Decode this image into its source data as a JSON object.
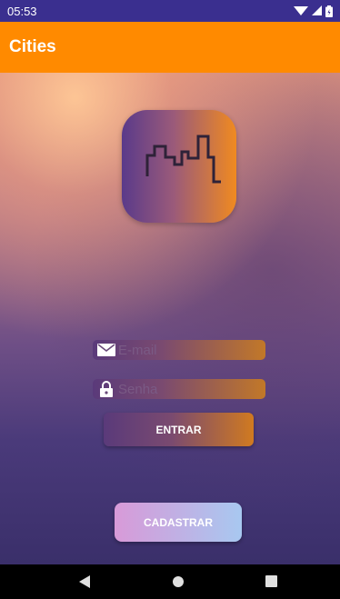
{
  "status_bar": {
    "time": "05:53",
    "icons": [
      "wifi-icon",
      "signal-icon",
      "battery-icon"
    ]
  },
  "app_bar": {
    "title": "Cities",
    "color": "#ff8a00"
  },
  "logo": {
    "icon": "city-skyline-icon"
  },
  "form": {
    "email": {
      "icon": "mail-icon",
      "placeholder": "E-mail",
      "value": ""
    },
    "password": {
      "icon": "lock-icon",
      "placeholder": "Senha",
      "value": ""
    },
    "login_button_label": "ENTRAR",
    "register_button_label": "CADASTRAR"
  },
  "nav_bar": {
    "buttons": [
      "back-icon",
      "home-icon",
      "recents-icon"
    ]
  }
}
